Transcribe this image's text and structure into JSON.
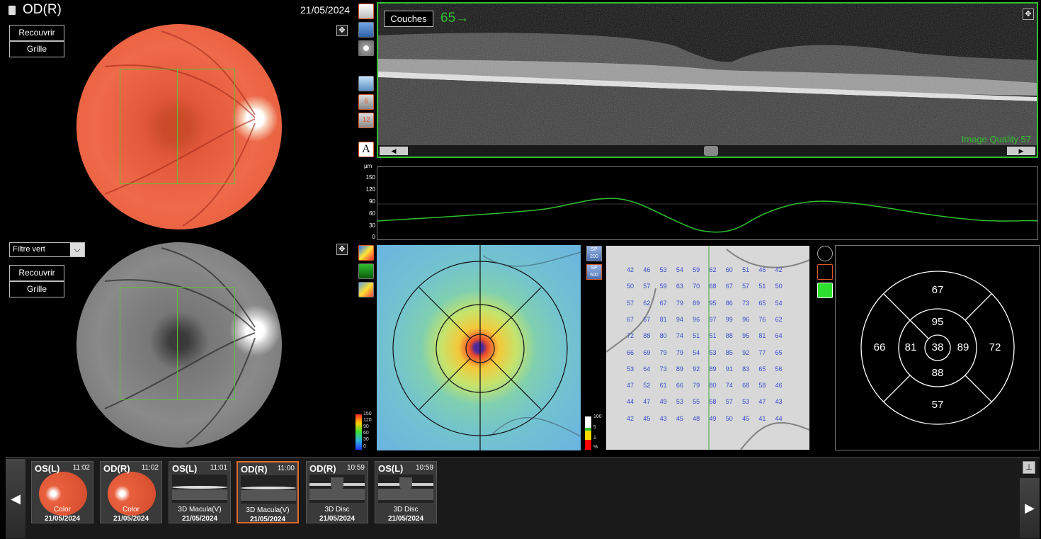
{
  "header": {
    "eye": "OD(R)",
    "date": "21/05/2024"
  },
  "fundus_top": {
    "overlay_label": "Recouvrir",
    "grid_label": "Grille"
  },
  "fundus_bottom": {
    "filter_value": "Filtre vert",
    "overlay_label": "Recouvrir",
    "grid_label": "Grille"
  },
  "oct": {
    "layers_label": "Couches",
    "slice_label": "65→",
    "quality_label": "Image Quality 57"
  },
  "thickness_profile": {
    "unit": "µm",
    "ticks": [
      "150",
      "120",
      "90",
      "60",
      "30",
      "0"
    ]
  },
  "scale_bar": {
    "ticks": [
      "150",
      "120",
      "90",
      "60",
      "30",
      "0"
    ]
  },
  "sp_buttons": [
    "SP 200",
    "SP 600"
  ],
  "normative_scale": {
    "ticks": [
      "100",
      "5",
      "1",
      "%"
    ]
  },
  "number_grid": [
    [
      "42",
      "46",
      "53",
      "54",
      "59",
      "62",
      "60",
      "51",
      "46",
      "42"
    ],
    [
      "50",
      "57",
      "59",
      "63",
      "70",
      "68",
      "67",
      "57",
      "51",
      "50"
    ],
    [
      "57",
      "62",
      "67",
      "79",
      "89",
      "95",
      "86",
      "73",
      "65",
      "54"
    ],
    [
      "67",
      "67",
      "81",
      "94",
      "96",
      "97",
      "99",
      "96",
      "76",
      "62"
    ],
    [
      "72",
      "88",
      "80",
      "74",
      "51",
      "51",
      "88",
      "95",
      "81",
      "64"
    ],
    [
      "66",
      "69",
      "79",
      "79",
      "54",
      "53",
      "85",
      "92",
      "77",
      "65"
    ],
    [
      "53",
      "64",
      "73",
      "89",
      "92",
      "89",
      "91",
      "83",
      "65",
      "56"
    ],
    [
      "47",
      "52",
      "61",
      "66",
      "79",
      "80",
      "74",
      "68",
      "58",
      "46"
    ],
    [
      "44",
      "47",
      "49",
      "53",
      "55",
      "58",
      "57",
      "53",
      "47",
      "43"
    ],
    [
      "42",
      "45",
      "43",
      "45",
      "48",
      "49",
      "50",
      "45",
      "41",
      "44"
    ]
  ],
  "etdrs": {
    "center": "38",
    "inner_top": "95",
    "inner_bottom": "88",
    "inner_left": "81",
    "inner_right": "89",
    "outer_top": "67",
    "outer_bottom": "57",
    "outer_left": "66",
    "outer_right": "72"
  },
  "thumbnails": [
    {
      "eye": "OS(L)",
      "time": "11:02",
      "type": "Color",
      "date": "21/05/2024",
      "kind": "fundus",
      "selected": false
    },
    {
      "eye": "OD(R)",
      "time": "11:02",
      "type": "Color",
      "date": "21/05/2024",
      "kind": "fundus",
      "selected": false
    },
    {
      "eye": "OS(L)",
      "time": "11:01",
      "type": "3D Macula(V)",
      "date": "21/05/2024",
      "kind": "oct",
      "selected": false
    },
    {
      "eye": "OD(R)",
      "time": "11:00",
      "type": "3D Macula(V)",
      "date": "21/05/2024",
      "kind": "oct",
      "selected": true
    },
    {
      "eye": "OD(R)",
      "time": "10:59",
      "type": "3D Disc",
      "date": "21/05/2024",
      "kind": "disc",
      "selected": false
    },
    {
      "eye": "OS(L)",
      "time": "10:59",
      "type": "3D Disc",
      "date": "21/05/2024",
      "kind": "disc",
      "selected": false
    }
  ],
  "colors": {
    "accent_green": "#2fbf2f",
    "selected_orange": "#e06a30",
    "grid_number_blue": "#3b4bd0"
  },
  "icons": [
    "clipboard-icon",
    "layers-view-icon",
    "3d-cube-icon",
    "disc-icon",
    "layer-select-icon",
    "grid-6-icon",
    "grid-12-icon",
    "annotation-a-icon",
    "expand-icon",
    "thickness-map-icon",
    "green-map-icon",
    "3d-surface-icon",
    "etdrs-chart-icon",
    "circle-grid-icon",
    "green-grid-icon",
    "scroll-left-arrow-icon",
    "scroll-right-arrow-icon",
    "pin-icon"
  ]
}
